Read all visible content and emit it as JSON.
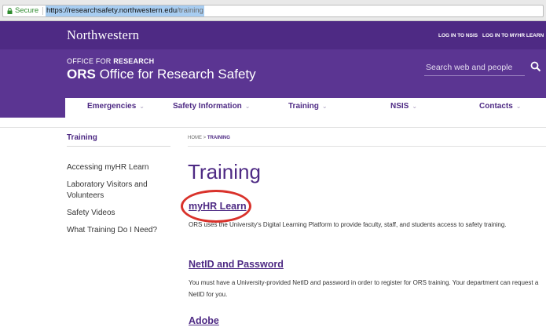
{
  "browser": {
    "secure_label": "Secure",
    "url_host": "https://researchsafety.northwestern.edu",
    "url_path": "/training"
  },
  "header": {
    "wordmark": "Northwestern",
    "util_links": [
      "LOG IN TO NSIS",
      "LOG IN TO MYHR LEARN"
    ],
    "office_prefix": "OFFICE FOR ",
    "office_bold": "RESEARCH",
    "site_title_bold": "ORS",
    "site_title_rest": " Office for Research Safety",
    "search_placeholder": "Search web and people"
  },
  "nav": {
    "items": [
      "Emergencies",
      "Safety Information",
      "Training",
      "NSIS",
      "Contacts"
    ]
  },
  "sidebar": {
    "title": "Training",
    "links": [
      "Accessing myHR Learn",
      "Laboratory Visitors and Volunteers",
      "Safety Videos",
      "What Training Do I Need?"
    ]
  },
  "breadcrumb": {
    "home": "HOME",
    "separator": ">",
    "current": "TRAINING"
  },
  "main": {
    "title": "Training",
    "sections": [
      {
        "heading": "myHR Learn",
        "text": "ORS uses the University's Digital Learning Platform to provide faculty, staff, and students access to safety training."
      },
      {
        "heading": "NetID and Password",
        "text": "You must have a University-provided NetID and password in order to register for ORS training. Your department can request a NetID for you."
      },
      {
        "heading": "Adobe",
        "text": ""
      }
    ]
  },
  "annotation": {
    "color": "#d9322b"
  },
  "colors": {
    "brand_purple": "#4e2a84",
    "banner_purple": "#5b3592"
  }
}
